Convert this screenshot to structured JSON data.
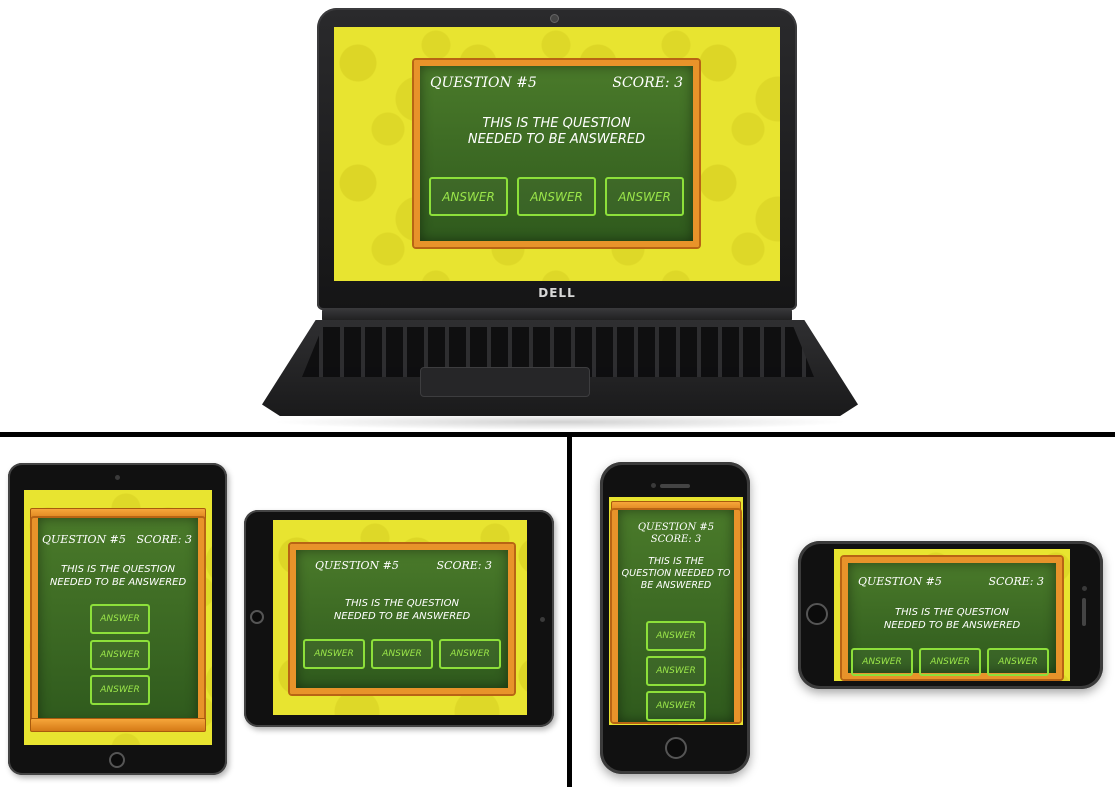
{
  "brand": "DELL",
  "game": {
    "question_label": "QUESTION #5",
    "score_label": "SCORE: 3",
    "question_line1": "THIS IS THE QUESTION",
    "question_line2": "NEEDED TO BE ANSWERED",
    "phone_portrait_line1": "THIS IS THE",
    "phone_portrait_line2": "QUESTION NEEDED TO",
    "phone_portrait_line3": "BE ANSWERED",
    "answer_label": "ANSWER"
  },
  "colors": {
    "background_yellow": "#e8e430",
    "board_green": "#3d6b24",
    "frame_orange": "#e8932a",
    "answer_green": "#9be64a"
  }
}
